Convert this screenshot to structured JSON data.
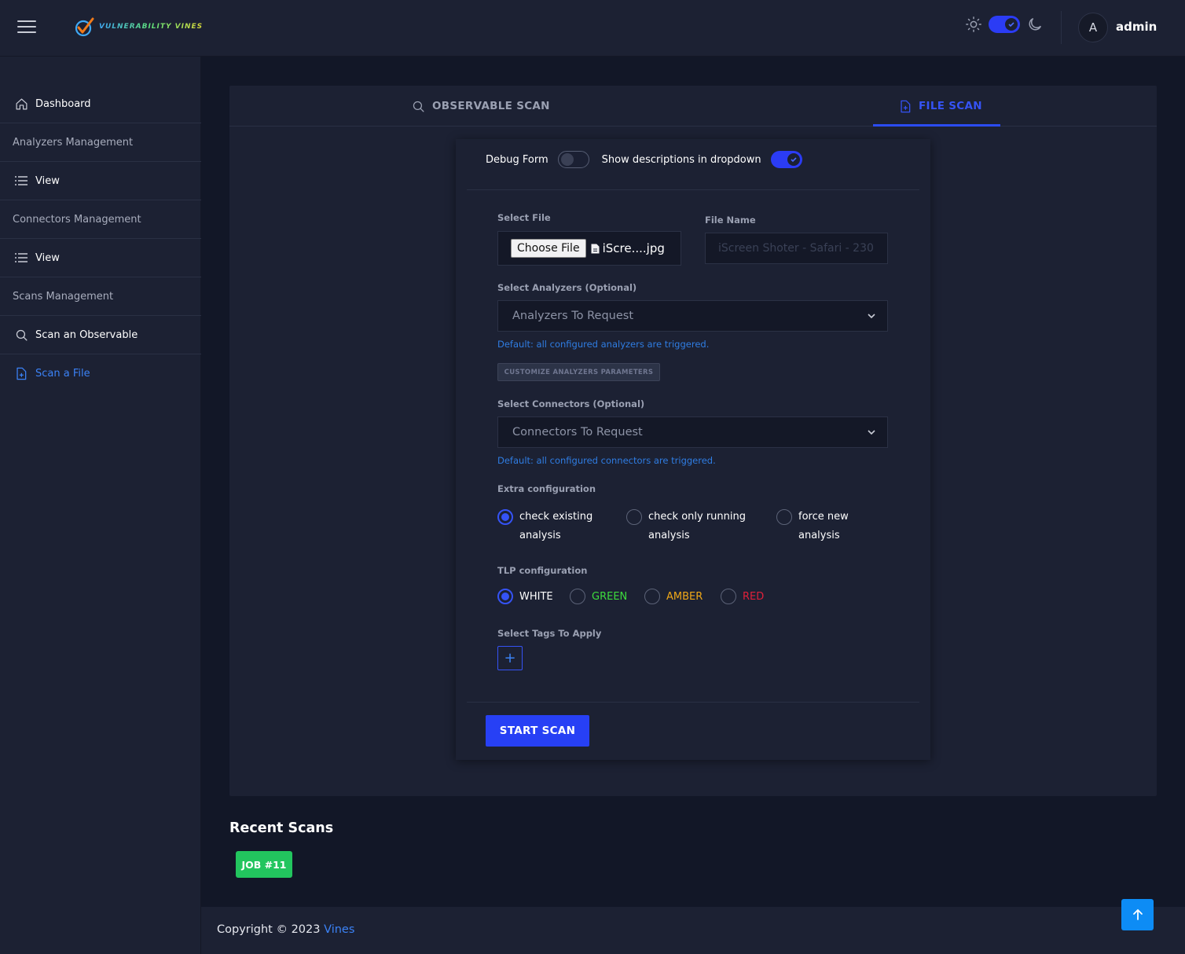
{
  "brand": {
    "logo_text": "VULNERABILITY VINES"
  },
  "header": {
    "avatar_initial": "A",
    "user_name": "admin"
  },
  "sidebar": {
    "items": [
      {
        "label": "Dashboard",
        "icon": "home-icon"
      },
      {
        "label": "Analyzers Management",
        "icon": ""
      },
      {
        "label": "View",
        "icon": "list-icon"
      },
      {
        "label": "Connectors Management",
        "icon": ""
      },
      {
        "label": "View",
        "icon": "list-icon"
      },
      {
        "label": "Scans Management",
        "icon": ""
      },
      {
        "label": "Scan an Observable",
        "icon": "search-icon"
      },
      {
        "label": "Scan a File",
        "icon": "file-plus-icon",
        "active": true
      }
    ]
  },
  "tabs": [
    {
      "label": "OBSERVABLE SCAN",
      "icon": "search-icon"
    },
    {
      "label": "FILE SCAN",
      "icon": "file-plus-icon",
      "active": true
    }
  ],
  "form": {
    "debug_label": "Debug Form",
    "debug_enabled": false,
    "descriptions_label": "Show descriptions in dropdown",
    "descriptions_enabled": true,
    "select_file_label": "Select File",
    "choose_file_label": "Choose File",
    "chosen_file": "iScre....jpg",
    "file_name_label": "File Name",
    "file_name_value": "iScreen Shoter - Safari - 230",
    "analyzers_label": "Select Analyzers (Optional)",
    "analyzers_placeholder": "Analyzers To Request",
    "analyzers_hint": "Default: all configured analyzers are triggered.",
    "customize_button": "CUSTOMIZE ANALYZERS PARAMETERS",
    "connectors_label": "Select Connectors (Optional)",
    "connectors_placeholder": "Connectors To Request",
    "connectors_hint": "Default: all configured connectors are triggered.",
    "extra_label": "Extra configuration",
    "extra_options": [
      {
        "line1": "check existing",
        "line2": "analysis",
        "checked": true
      },
      {
        "line1": "check only running",
        "line2": "analysis",
        "checked": false
      },
      {
        "line1": "force new",
        "line2": "analysis",
        "checked": false
      }
    ],
    "tlp_label": "TLP configuration",
    "tlp_options": [
      {
        "label": "WHITE",
        "color": "#ffffff",
        "checked": true
      },
      {
        "label": "GREEN",
        "color": "#3ddc3d",
        "checked": false
      },
      {
        "label": "AMBER",
        "color": "#f0a818",
        "checked": false
      },
      {
        "label": "RED",
        "color": "#e0203a",
        "checked": false
      }
    ],
    "tags_label": "Select Tags To Apply",
    "add_tag_symbol": "+",
    "start_button": "START SCAN"
  },
  "recent": {
    "title": "Recent Scans",
    "jobs": [
      "JOB #11"
    ]
  },
  "footer": {
    "copyright": "Copyright © 2023 ",
    "brand": "Vines"
  },
  "colors": {
    "accent": "#2740f5",
    "link": "#3b82f6",
    "success": "#22c55e",
    "background": "#121727",
    "surface": "#1c2133"
  }
}
